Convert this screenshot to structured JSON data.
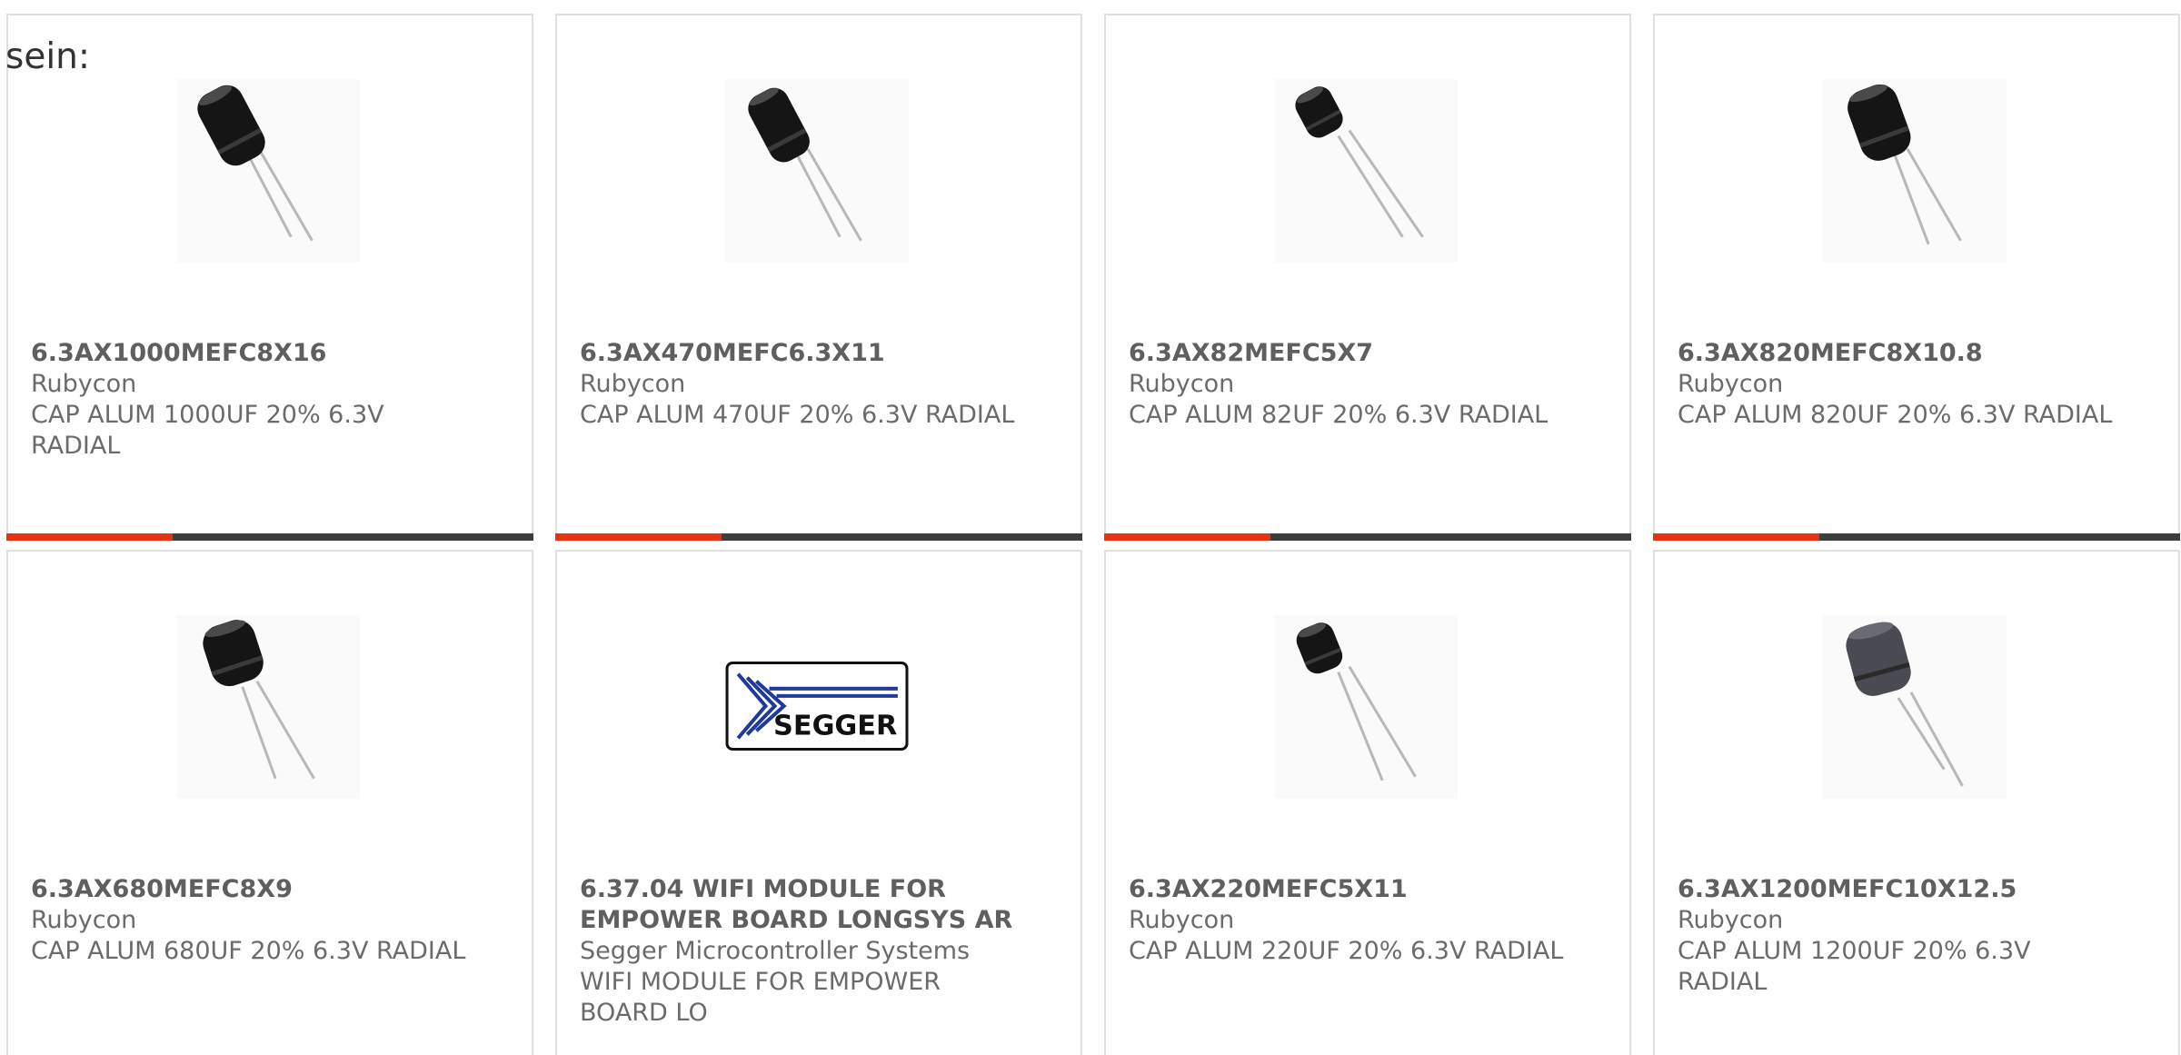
{
  "intro_text": "sein:",
  "colors": {
    "accent": "#e63312",
    "bar": "#3d3d3d",
    "border": "#e0e0e0",
    "text": "#6b6b6b"
  },
  "products": [
    {
      "part": "6.3AX1000MEFC8X16",
      "maker": "Rubycon",
      "desc": "CAP ALUM 1000UF 20% 6.3V RADIAL",
      "image": "radial-capacitor",
      "accent_bar": true
    },
    {
      "part": "6.3AX470MEFC6.3X11",
      "maker": "Rubycon",
      "desc": "CAP ALUM 470UF 20% 6.3V RADIAL",
      "image": "radial-capacitor",
      "accent_bar": true
    },
    {
      "part": "6.3AX82MEFC5X7",
      "maker": "Rubycon",
      "desc": "CAP ALUM 82UF 20% 6.3V RADIAL",
      "image": "radial-capacitor-small",
      "accent_bar": true
    },
    {
      "part": "6.3AX820MEFC8X10.8",
      "maker": "Rubycon",
      "desc": "CAP ALUM 820UF 20% 6.3V RADIAL",
      "image": "radial-capacitor",
      "accent_bar": true
    },
    {
      "part": "6.3AX680MEFC8X9",
      "maker": "Rubycon",
      "desc": "CAP ALUM 680UF 20% 6.3V RADIAL",
      "image": "radial-capacitor",
      "accent_bar": false
    },
    {
      "part": "6.37.04 WIFI MODULE FOR EMPOWER BOARD LONGSYS AR",
      "maker": "Segger Microcontroller Systems",
      "desc": "WIFI MODULE FOR EMPOWER BOARD LO",
      "image": "segger-logo",
      "logo_text": "SEGGER",
      "accent_bar": false
    },
    {
      "part": "6.3AX220MEFC5X11",
      "maker": "Rubycon",
      "desc": "CAP ALUM 220UF 20% 6.3V RADIAL",
      "image": "radial-capacitor-small",
      "accent_bar": false
    },
    {
      "part": "6.3AX1200MEFC10X12.5",
      "maker": "Rubycon",
      "desc": "CAP ALUM 1200UF 20% 6.3V RADIAL",
      "image": "radial-capacitor-grey",
      "accent_bar": false
    }
  ]
}
